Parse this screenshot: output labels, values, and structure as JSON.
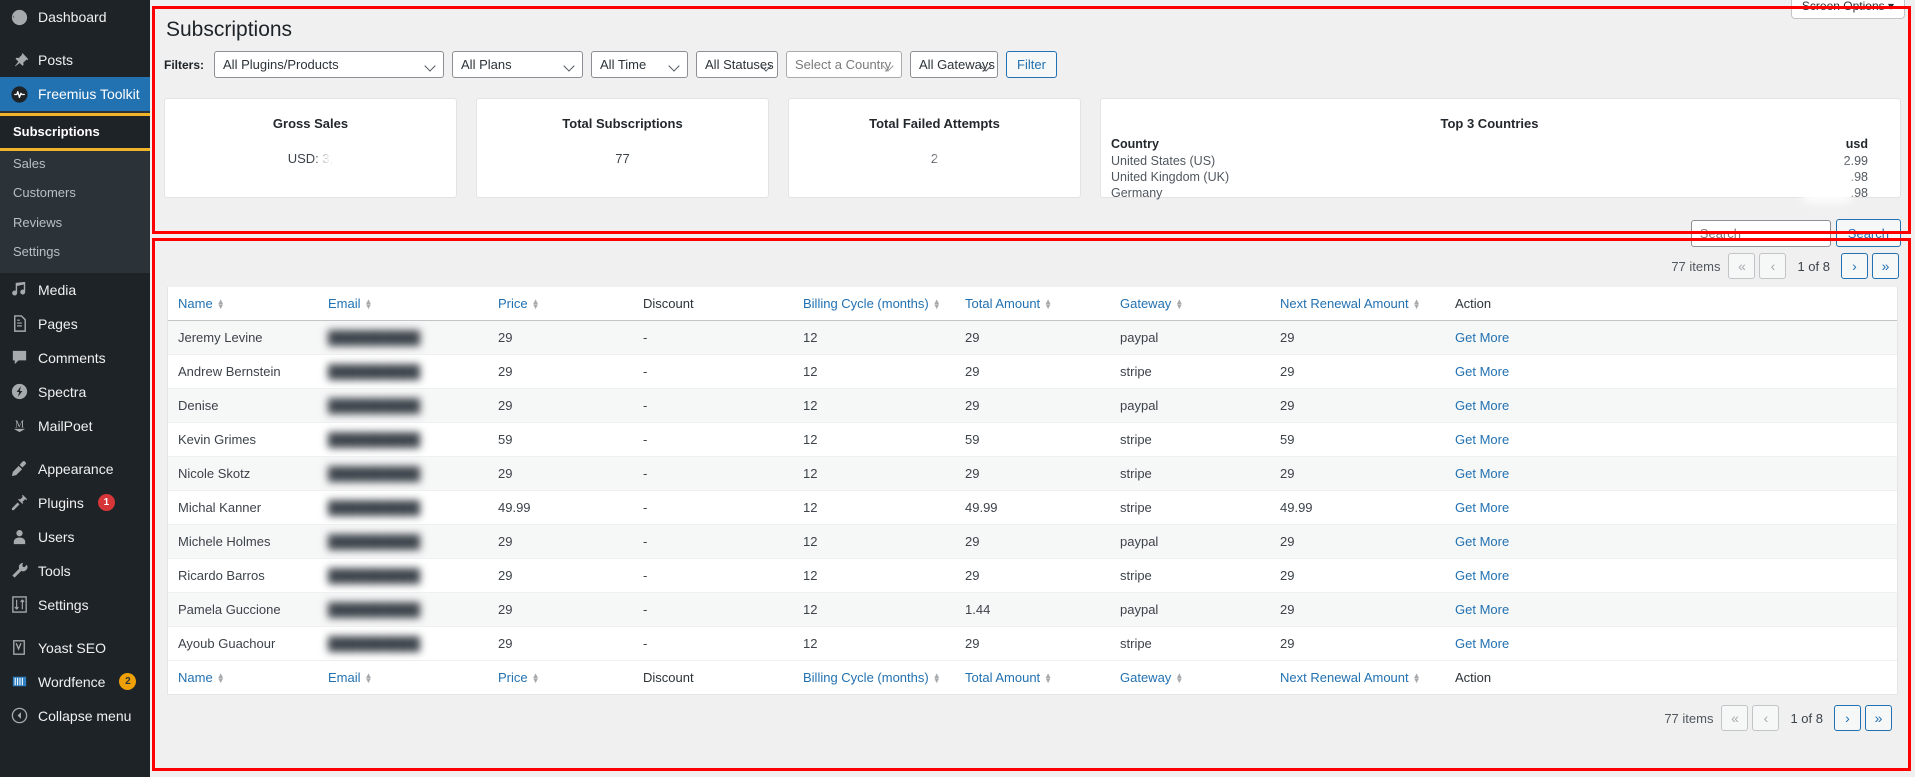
{
  "sidebar": {
    "items": [
      {
        "label": "Dashboard",
        "icon": "dashboard-icon",
        "name": "dashboard"
      },
      {
        "label": "Posts",
        "icon": "pin-icon",
        "name": "posts"
      },
      {
        "label": "Freemius Toolkit",
        "icon": "freemius-icon",
        "name": "freemius-toolkit",
        "current": true
      },
      {
        "label": "Media",
        "icon": "media-icon",
        "name": "media"
      },
      {
        "label": "Pages",
        "icon": "pages-icon",
        "name": "pages"
      },
      {
        "label": "Comments",
        "icon": "comments-icon",
        "name": "comments"
      },
      {
        "label": "Spectra",
        "icon": "spectra-icon",
        "name": "spectra"
      },
      {
        "label": "MailPoet",
        "icon": "mailpoet-icon",
        "name": "mailpoet"
      },
      {
        "label": "Appearance",
        "icon": "appearance-icon",
        "name": "appearance"
      },
      {
        "label": "Plugins",
        "icon": "plugins-icon",
        "name": "plugins",
        "badge": "1"
      },
      {
        "label": "Users",
        "icon": "users-icon",
        "name": "users"
      },
      {
        "label": "Tools",
        "icon": "tools-icon",
        "name": "tools"
      },
      {
        "label": "Settings",
        "icon": "settings-icon",
        "name": "settings"
      },
      {
        "label": "Yoast SEO",
        "icon": "yoast-icon",
        "name": "yoast-seo"
      },
      {
        "label": "Wordfence",
        "icon": "wordfence-icon",
        "name": "wordfence",
        "badge": "2"
      },
      {
        "label": "Collapse menu",
        "icon": "collapse-icon",
        "name": "collapse-menu"
      }
    ],
    "submenu": [
      {
        "label": "Subscriptions",
        "active": true
      },
      {
        "label": "Sales",
        "active": false
      },
      {
        "label": "Customers",
        "active": false
      },
      {
        "label": "Reviews",
        "active": false
      },
      {
        "label": "Settings",
        "active": false
      }
    ]
  },
  "header": {
    "screen_options": "Screen Options",
    "title": "Subscriptions"
  },
  "filters": {
    "label": "Filters:",
    "products": "All Plugins/Products",
    "plans": "All Plans",
    "time": "All Time",
    "statuses": "All Statuses",
    "country_placeholder": "Select a Country",
    "gateways": "All Gateways",
    "filter_button": "Filter"
  },
  "cards": {
    "gross_sales": {
      "title": "Gross Sales",
      "value": "USD: 3,"
    },
    "total_subscriptions": {
      "title": "Total Subscriptions",
      "value": "77"
    },
    "total_failed_attempts": {
      "title": "Total Failed Attempts",
      "value": "2"
    },
    "top_countries": {
      "title": "Top 3 Countries",
      "col_country": "Country",
      "col_usd": "usd",
      "rows": [
        {
          "country": "United States (US)",
          "usd": "2.99"
        },
        {
          "country": "United Kingdom (UK)",
          "usd": ".98"
        },
        {
          "country": "Germany",
          "usd": ".98"
        }
      ]
    }
  },
  "search": {
    "placeholder": "Search",
    "value": "",
    "button": "Search"
  },
  "pagination": {
    "items": "77 items",
    "first": "«",
    "prev": "‹",
    "current": "1 of 8",
    "next": "›",
    "last": "»"
  },
  "table": {
    "columns": [
      {
        "label": "Name",
        "sortable": true,
        "key": "name"
      },
      {
        "label": "Email",
        "sortable": true,
        "key": "email"
      },
      {
        "label": "Price",
        "sortable": true,
        "key": "price"
      },
      {
        "label": "Discount",
        "sortable": false,
        "key": "discount"
      },
      {
        "label": "Billing Cycle (months)",
        "sortable": true,
        "key": "billing"
      },
      {
        "label": "Total Amount",
        "sortable": true,
        "key": "total"
      },
      {
        "label": "Gateway",
        "sortable": true,
        "key": "gateway"
      },
      {
        "label": "Next Renewal Amount",
        "sortable": true,
        "key": "renewal"
      },
      {
        "label": "Action",
        "sortable": false,
        "key": "action"
      }
    ],
    "rows": [
      {
        "name": "Jeremy Levine",
        "email": "██████████",
        "price": "29",
        "discount": "-",
        "billing": "12",
        "total": "29",
        "gateway": "paypal",
        "renewal": "29",
        "action": "Get More"
      },
      {
        "name": "Andrew Bernstein",
        "email": "██████████",
        "price": "29",
        "discount": "-",
        "billing": "12",
        "total": "29",
        "gateway": "stripe",
        "renewal": "29",
        "action": "Get More"
      },
      {
        "name": "Denise",
        "email": "██████████",
        "price": "29",
        "discount": "-",
        "billing": "12",
        "total": "29",
        "gateway": "paypal",
        "renewal": "29",
        "action": "Get More"
      },
      {
        "name": "Kevin Grimes",
        "email": "██████████",
        "price": "59",
        "discount": "-",
        "billing": "12",
        "total": "59",
        "gateway": "stripe",
        "renewal": "59",
        "action": "Get More"
      },
      {
        "name": "Nicole Skotz",
        "email": "██████████",
        "price": "29",
        "discount": "-",
        "billing": "12",
        "total": "29",
        "gateway": "stripe",
        "renewal": "29",
        "action": "Get More"
      },
      {
        "name": "Michal Kanner",
        "email": "██████████",
        "price": "49.99",
        "discount": "-",
        "billing": "12",
        "total": "49.99",
        "gateway": "stripe",
        "renewal": "49.99",
        "action": "Get More"
      },
      {
        "name": "Michele Holmes",
        "email": "██████████",
        "price": "29",
        "discount": "-",
        "billing": "12",
        "total": "29",
        "gateway": "paypal",
        "renewal": "29",
        "action": "Get More"
      },
      {
        "name": "Ricardo Barros",
        "email": "██████████",
        "price": "29",
        "discount": "-",
        "billing": "12",
        "total": "29",
        "gateway": "stripe",
        "renewal": "29",
        "action": "Get More"
      },
      {
        "name": "Pamela Guccione",
        "email": "██████████",
        "price": "29",
        "discount": "-",
        "billing": "12",
        "total": "1.44",
        "gateway": "paypal",
        "renewal": "29",
        "action": "Get More"
      },
      {
        "name": "Ayoub Guachour",
        "email": "██████████",
        "price": "29",
        "discount": "-",
        "billing": "12",
        "total": "29",
        "gateway": "stripe",
        "renewal": "29",
        "action": "Get More"
      }
    ]
  },
  "colors": {
    "wp_blue": "#2271b1",
    "sidebar_bg": "#1d2327",
    "submenu_bg": "#2c3338",
    "annotation_red": "#fe0000",
    "highlight_amber": "#f0b429",
    "badge_red": "#d63638",
    "badge_amber": "#f0a007"
  }
}
